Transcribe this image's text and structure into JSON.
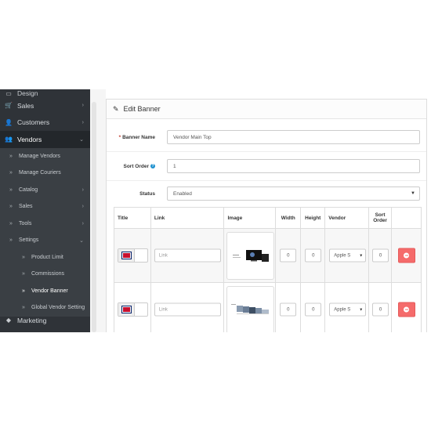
{
  "sidebar": {
    "items": [
      {
        "label": "Design",
        "icon": "desktop-icon",
        "cutoff": true
      },
      {
        "label": "Sales",
        "icon": "cart-icon",
        "chevron": "›"
      },
      {
        "label": "Customers",
        "icon": "user-icon",
        "chevron": "›"
      },
      {
        "label": "Vendors",
        "icon": "users-icon",
        "chevron": "⌄",
        "active": true
      }
    ],
    "vendor_sub": [
      {
        "label": "Manage Vendors"
      },
      {
        "label": "Manage Couriers"
      },
      {
        "label": "Catalog",
        "chevron": "›"
      },
      {
        "label": "Sales",
        "chevron": "›"
      },
      {
        "label": "Tools",
        "chevron": "›"
      },
      {
        "label": "Settings",
        "chevron": "⌄"
      }
    ],
    "settings_sub": [
      {
        "label": "Product Limit"
      },
      {
        "label": "Commissions"
      },
      {
        "label": "Vendor Banner",
        "current": true
      },
      {
        "label": "Global Vendor Setting"
      }
    ],
    "bottom": {
      "label": "Marketing",
      "icon": "share-icon"
    }
  },
  "panel": {
    "title": "Edit Banner",
    "banner_name_label": "Banner Name",
    "banner_name_value": "Vendor Main Top",
    "sort_order_label": "Sort Order",
    "sort_order_value": "1",
    "status_label": "Status",
    "status_value": "Enabled"
  },
  "table": {
    "headers": {
      "title": "Title",
      "link": "Link",
      "image": "Image",
      "width": "Width",
      "height": "Height",
      "vendor": "Vendor",
      "sort_order": "Sort Order"
    },
    "rows": [
      {
        "link_placeholder": "Link",
        "width": "0",
        "height": "0",
        "vendor": "Apple S",
        "sort": "0"
      },
      {
        "link_placeholder": "Link",
        "width": "0",
        "height": "0",
        "vendor": "Apple S",
        "sort": "0"
      }
    ]
  },
  "colors": {
    "sidebar_bg": "#2f3338",
    "accent_blue": "#1e91cf",
    "danger": "#f56b6b"
  }
}
